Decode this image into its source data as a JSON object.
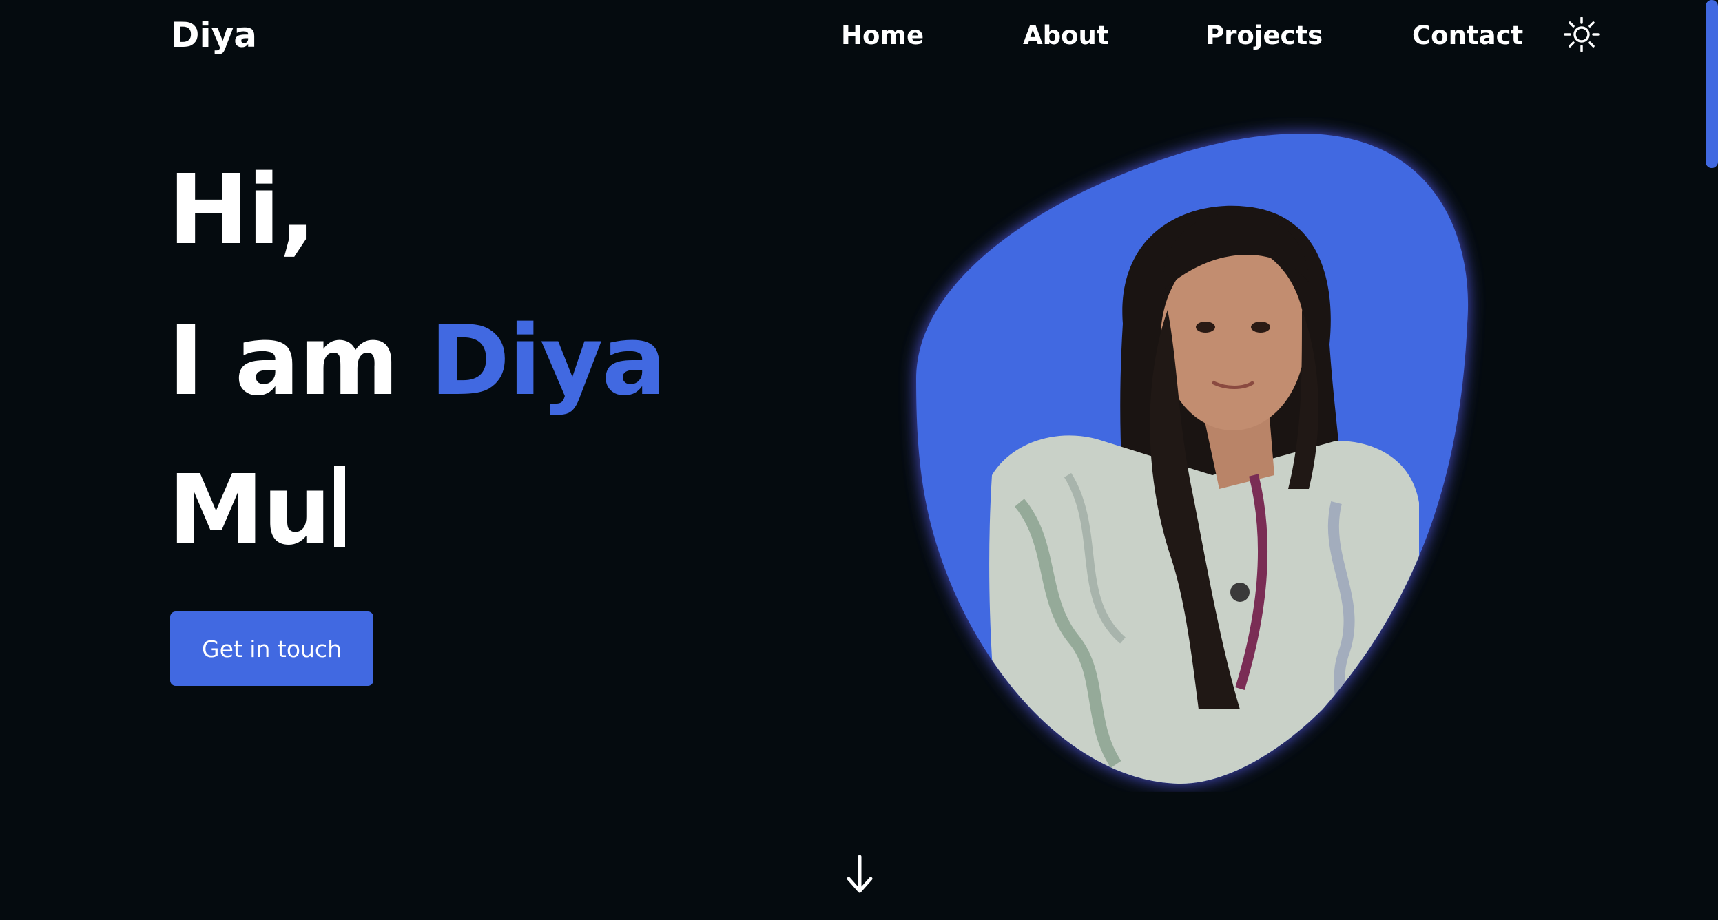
{
  "nav": {
    "logo": "Diya",
    "links": [
      "Home",
      "About",
      "Projects",
      "Contact"
    ],
    "theme_toggle_icon": "sun-icon"
  },
  "hero": {
    "greeting": "Hi,",
    "intro_prefix": "I am",
    "name": "Diya",
    "typed_text": "Mu",
    "cta_label": "Get in touch",
    "scroll_icon": "arrow-down-icon"
  },
  "colors": {
    "background": "#050b0f",
    "accent": "#4169e1",
    "text": "#ffffff"
  }
}
